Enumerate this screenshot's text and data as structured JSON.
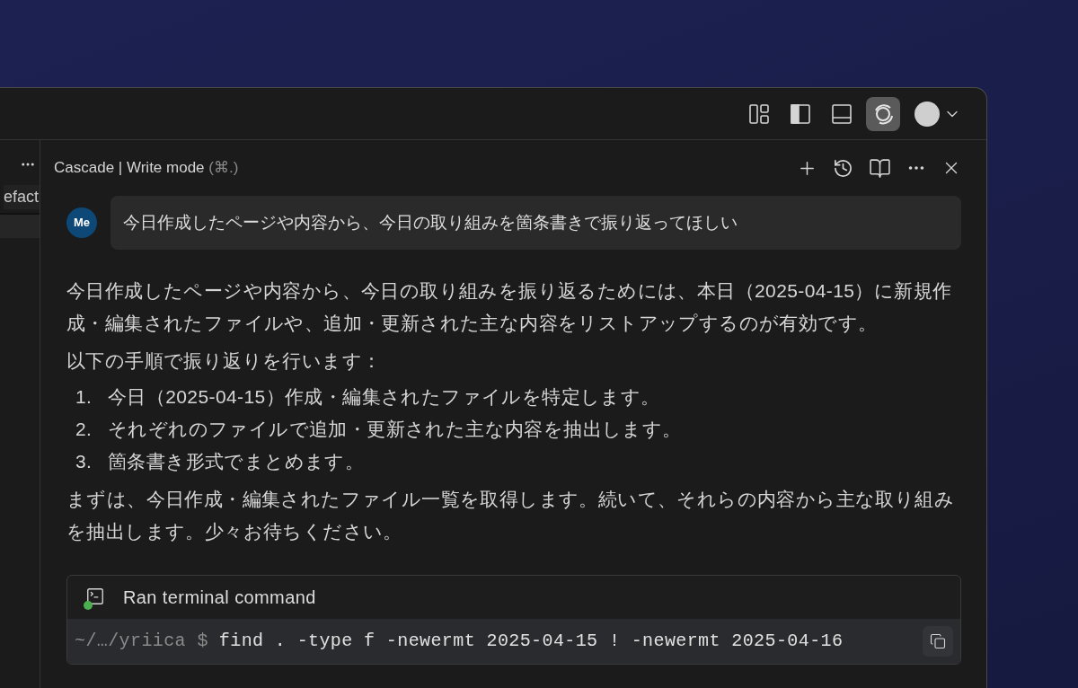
{
  "title_bar": {
    "toggles": [
      {
        "kind": "layout",
        "selected": false
      },
      {
        "kind": "sidebar",
        "selected": false
      },
      {
        "kind": "panel",
        "selected": false
      },
      {
        "kind": "cascade",
        "selected": true
      }
    ]
  },
  "side_strip": {
    "tab_text": "efact"
  },
  "chat": {
    "header": {
      "title": "Cascade | Write mode",
      "shortcut": "(⌘.)"
    },
    "user_message": {
      "avatar": "Me",
      "text": "今日作成したページや内容から、今日の取り組みを箇条書きで振り返ってほしい"
    },
    "response": {
      "paragraphs": [
        "今日作成したページや内容から、今日の取り組みを振り返るためには、本日（2025-04-15）に新規作成・編集されたファイルや、追加・更新された主な内容をリストアップするのが有効です。",
        "以下の手順で振り返りを行います："
      ],
      "steps": [
        {
          "number": "1.",
          "text": "今日（2025-04-15）作成・編集されたファイルを特定します。"
        },
        {
          "number": "2.",
          "text": "それぞれのファイルで追加・更新された主な内容を抽出します。"
        },
        {
          "number": "3.",
          "text": "箇条書き形式でまとめます。"
        }
      ],
      "closing": "まずは、今日作成・編集されたファイル一覧を取得します。続いて、それらの内容から主な取り組みを抽出します。少々お待ちください。"
    },
    "terminal": {
      "title": "Ran terminal command",
      "color": "#4caf50",
      "prompt": "~/…/yriica $",
      "command": "find . -type f -newermt 2025-04-15 ! -newermt 2025-04-16"
    }
  }
}
